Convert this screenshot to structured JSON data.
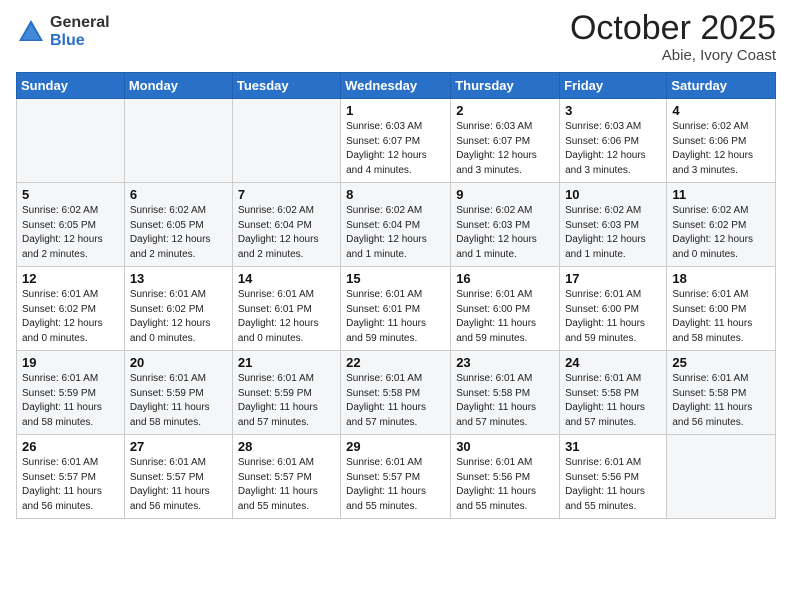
{
  "logo": {
    "general": "General",
    "blue": "Blue"
  },
  "header": {
    "month": "October 2025",
    "location": "Abie, Ivory Coast"
  },
  "weekdays": [
    "Sunday",
    "Monday",
    "Tuesday",
    "Wednesday",
    "Thursday",
    "Friday",
    "Saturday"
  ],
  "weeks": [
    [
      {
        "day": "",
        "info": ""
      },
      {
        "day": "",
        "info": ""
      },
      {
        "day": "",
        "info": ""
      },
      {
        "day": "1",
        "info": "Sunrise: 6:03 AM\nSunset: 6:07 PM\nDaylight: 12 hours\nand 4 minutes."
      },
      {
        "day": "2",
        "info": "Sunrise: 6:03 AM\nSunset: 6:07 PM\nDaylight: 12 hours\nand 3 minutes."
      },
      {
        "day": "3",
        "info": "Sunrise: 6:03 AM\nSunset: 6:06 PM\nDaylight: 12 hours\nand 3 minutes."
      },
      {
        "day": "4",
        "info": "Sunrise: 6:02 AM\nSunset: 6:06 PM\nDaylight: 12 hours\nand 3 minutes."
      }
    ],
    [
      {
        "day": "5",
        "info": "Sunrise: 6:02 AM\nSunset: 6:05 PM\nDaylight: 12 hours\nand 2 minutes."
      },
      {
        "day": "6",
        "info": "Sunrise: 6:02 AM\nSunset: 6:05 PM\nDaylight: 12 hours\nand 2 minutes."
      },
      {
        "day": "7",
        "info": "Sunrise: 6:02 AM\nSunset: 6:04 PM\nDaylight: 12 hours\nand 2 minutes."
      },
      {
        "day": "8",
        "info": "Sunrise: 6:02 AM\nSunset: 6:04 PM\nDaylight: 12 hours\nand 1 minute."
      },
      {
        "day": "9",
        "info": "Sunrise: 6:02 AM\nSunset: 6:03 PM\nDaylight: 12 hours\nand 1 minute."
      },
      {
        "day": "10",
        "info": "Sunrise: 6:02 AM\nSunset: 6:03 PM\nDaylight: 12 hours\nand 1 minute."
      },
      {
        "day": "11",
        "info": "Sunrise: 6:02 AM\nSunset: 6:02 PM\nDaylight: 12 hours\nand 0 minutes."
      }
    ],
    [
      {
        "day": "12",
        "info": "Sunrise: 6:01 AM\nSunset: 6:02 PM\nDaylight: 12 hours\nand 0 minutes."
      },
      {
        "day": "13",
        "info": "Sunrise: 6:01 AM\nSunset: 6:02 PM\nDaylight: 12 hours\nand 0 minutes."
      },
      {
        "day": "14",
        "info": "Sunrise: 6:01 AM\nSunset: 6:01 PM\nDaylight: 12 hours\nand 0 minutes."
      },
      {
        "day": "15",
        "info": "Sunrise: 6:01 AM\nSunset: 6:01 PM\nDaylight: 11 hours\nand 59 minutes."
      },
      {
        "day": "16",
        "info": "Sunrise: 6:01 AM\nSunset: 6:00 PM\nDaylight: 11 hours\nand 59 minutes."
      },
      {
        "day": "17",
        "info": "Sunrise: 6:01 AM\nSunset: 6:00 PM\nDaylight: 11 hours\nand 59 minutes."
      },
      {
        "day": "18",
        "info": "Sunrise: 6:01 AM\nSunset: 6:00 PM\nDaylight: 11 hours\nand 58 minutes."
      }
    ],
    [
      {
        "day": "19",
        "info": "Sunrise: 6:01 AM\nSunset: 5:59 PM\nDaylight: 11 hours\nand 58 minutes."
      },
      {
        "day": "20",
        "info": "Sunrise: 6:01 AM\nSunset: 5:59 PM\nDaylight: 11 hours\nand 58 minutes."
      },
      {
        "day": "21",
        "info": "Sunrise: 6:01 AM\nSunset: 5:59 PM\nDaylight: 11 hours\nand 57 minutes."
      },
      {
        "day": "22",
        "info": "Sunrise: 6:01 AM\nSunset: 5:58 PM\nDaylight: 11 hours\nand 57 minutes."
      },
      {
        "day": "23",
        "info": "Sunrise: 6:01 AM\nSunset: 5:58 PM\nDaylight: 11 hours\nand 57 minutes."
      },
      {
        "day": "24",
        "info": "Sunrise: 6:01 AM\nSunset: 5:58 PM\nDaylight: 11 hours\nand 57 minutes."
      },
      {
        "day": "25",
        "info": "Sunrise: 6:01 AM\nSunset: 5:58 PM\nDaylight: 11 hours\nand 56 minutes."
      }
    ],
    [
      {
        "day": "26",
        "info": "Sunrise: 6:01 AM\nSunset: 5:57 PM\nDaylight: 11 hours\nand 56 minutes."
      },
      {
        "day": "27",
        "info": "Sunrise: 6:01 AM\nSunset: 5:57 PM\nDaylight: 11 hours\nand 56 minutes."
      },
      {
        "day": "28",
        "info": "Sunrise: 6:01 AM\nSunset: 5:57 PM\nDaylight: 11 hours\nand 55 minutes."
      },
      {
        "day": "29",
        "info": "Sunrise: 6:01 AM\nSunset: 5:57 PM\nDaylight: 11 hours\nand 55 minutes."
      },
      {
        "day": "30",
        "info": "Sunrise: 6:01 AM\nSunset: 5:56 PM\nDaylight: 11 hours\nand 55 minutes."
      },
      {
        "day": "31",
        "info": "Sunrise: 6:01 AM\nSunset: 5:56 PM\nDaylight: 11 hours\nand 55 minutes."
      },
      {
        "day": "",
        "info": ""
      }
    ]
  ]
}
